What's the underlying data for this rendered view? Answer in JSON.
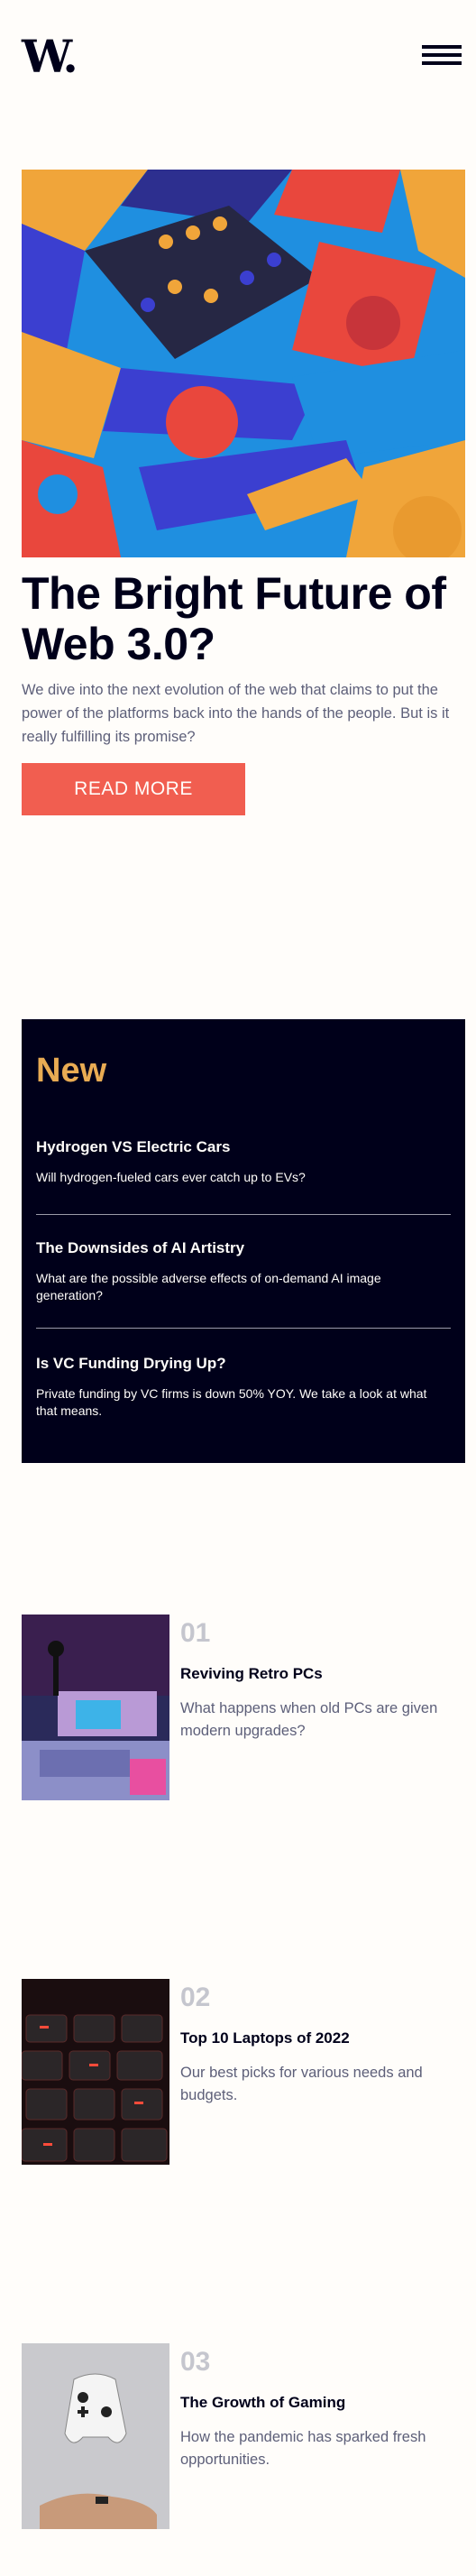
{
  "header": {
    "logo_text": "W.",
    "menu_icon": "hamburger-menu-icon"
  },
  "hero": {
    "image_icon": "abstract-3d-blocks-image",
    "title": "The Bright Future of Web 3.0?",
    "description": "We dive into the next evolution of the web that claims to put the power of the platforms back into the hands of the people. But is it really fulfilling its promise?",
    "button_label": "READ MORE",
    "button_color": "#f15e50"
  },
  "new_section": {
    "title": "New",
    "title_color": "#e9ab53",
    "background": "#00001a",
    "items": [
      {
        "title": "Hydrogen VS Electric Cars",
        "description": "Will hydrogen-fueled cars ever catch up to EVs?"
      },
      {
        "title": "The Downsides of AI Artistry",
        "description": "What are the possible adverse effects of on-demand AI image generation?"
      },
      {
        "title": "Is VC Funding Drying Up?",
        "description": "Private funding by VC firms is down 50% YOY. We take a look at what that means."
      }
    ]
  },
  "articles": [
    {
      "number": "01",
      "title": "Reviving Retro PCs",
      "description": "What happens when old PCs are given modern upgrades?",
      "image_icon": "retro-pc-image"
    },
    {
      "number": "02",
      "title": "Top 10 Laptops of 2022",
      "description": "Our best picks for various needs and budgets.",
      "image_icon": "laptop-keyboard-image"
    },
    {
      "number": "03",
      "title": "The Growth of Gaming",
      "description": "How the pandemic has sparked fresh opportunities.",
      "image_icon": "game-controller-image"
    }
  ]
}
